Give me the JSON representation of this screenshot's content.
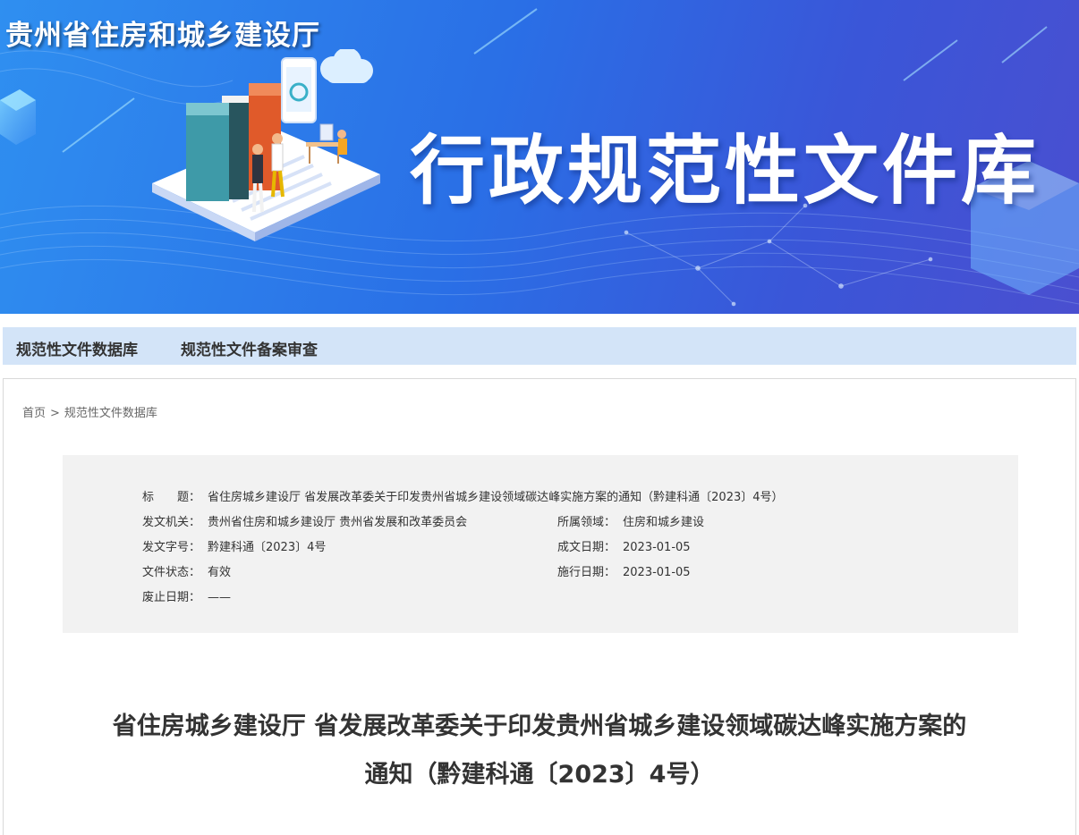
{
  "header": {
    "site_title": "贵州省住房和城乡建设厅",
    "banner_title": "行政规范性文件库",
    "banner_illustration": "books-and-phone-illustration",
    "colors": {
      "banner_start": "#2f8ff0",
      "banner_end": "#4a4fd0",
      "nav_bg": "#d3e4f8"
    }
  },
  "nav": {
    "items": [
      {
        "label": "规范性文件数据库"
      },
      {
        "label": "规范性文件备案审查"
      }
    ]
  },
  "breadcrumb": {
    "home": "首页",
    "separator": ">",
    "current": "规范性文件数据库"
  },
  "meta": {
    "title_label": "标　　题：",
    "title_value": "省住房城乡建设厅 省发展改革委关于印发贵州省城乡建设领域碳达峰实施方案的通知（黔建科通〔2023〕4号）",
    "issuer_label": "发文机关：",
    "issuer_value": "贵州省住房和城乡建设厅 贵州省发展和改革委员会",
    "domain_label": "所属领域：",
    "domain_value": "住房和城乡建设",
    "docno_label": "发文字号：",
    "docno_value": "黔建科通〔2023〕4号",
    "created_label": "成文日期：",
    "created_value": "2023-01-05",
    "status_label": "文件状态：",
    "status_value": "有效",
    "effective_label": "施行日期：",
    "effective_value": "2023-01-05",
    "repeal_label": "废止日期：",
    "repeal_value": "——"
  },
  "document": {
    "title_line1": "省住房城乡建设厅 省发展改革委关于印发贵州省城乡建设领域碳达峰实施方案的",
    "title_line2": "通知（黔建科通〔2023〕4号）"
  }
}
